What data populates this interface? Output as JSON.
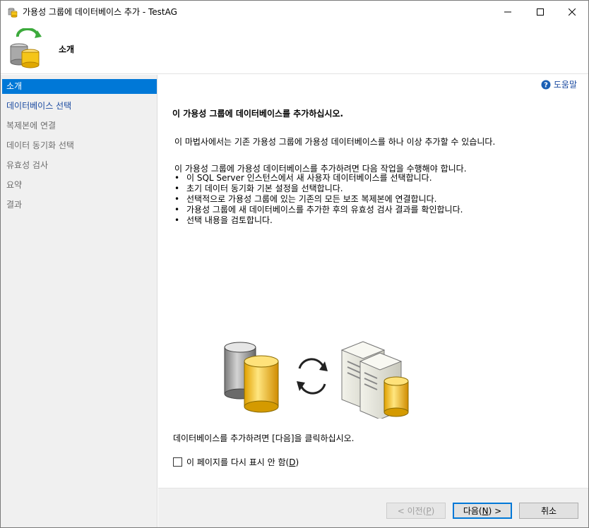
{
  "window": {
    "title": "가용성 그룹에 데이터베이스 추가 - TestAG"
  },
  "header": {
    "title": "소개"
  },
  "sidebar": {
    "items": [
      {
        "label": "소개",
        "state": "active"
      },
      {
        "label": "데이터베이스 선택",
        "state": "link"
      },
      {
        "label": "복제본에 연결",
        "state": "disabled"
      },
      {
        "label": "데이터 동기화 선택",
        "state": "disabled"
      },
      {
        "label": "유효성 검사",
        "state": "disabled"
      },
      {
        "label": "요약",
        "state": "disabled"
      },
      {
        "label": "결과",
        "state": "disabled"
      }
    ]
  },
  "main": {
    "help_label": "도움말",
    "heading": "이 가용성 그룹에 데이터베이스를 추가하십시오.",
    "intro": "이 마법사에서는 기존 가용성 그룹에 가용성 데이터베이스를 하나 이상 추가할 수 있습니다.",
    "steps_intro": "이 가용성 그룹에 가용성 데이터베이스를 추가하려면 다음 작업을 수행해야 합니다.",
    "bullet": "•",
    "steps": [
      "이 SQL Server 인스턴스에서 새 사용자 데이터베이스를 선택합니다.",
      "초기 데이터 동기화 기본 설정을 선택합니다.",
      "선택적으로 가용성 그룹에 있는 기존의 모든 보조 복제본에 연결합니다.",
      "가용성 그룹에 새 데이터베이스를 추가한 후의 유효성 검사 결과를 확인합니다.",
      "선택 내용을 검토합니다."
    ],
    "next_hint": "데이터베이스를 추가하려면 [다음]을 클릭하십시오.",
    "checkbox": {
      "label": "이 페이지를 다시 표시 안 함(",
      "mnemonic": "D",
      "label_end": ")",
      "checked": false
    }
  },
  "footer": {
    "prev": {
      "label": "< 이전(",
      "mnemonic": "P",
      "label_end": ")",
      "enabled": false
    },
    "next": {
      "label": "다음(",
      "mnemonic": "N",
      "label_end": ") >",
      "enabled": true
    },
    "cancel": {
      "label": "취소"
    }
  },
  "colors": {
    "accent": "#0078d7",
    "link": "#1a4aa0",
    "sidebar_bg": "#f0f0f0"
  }
}
